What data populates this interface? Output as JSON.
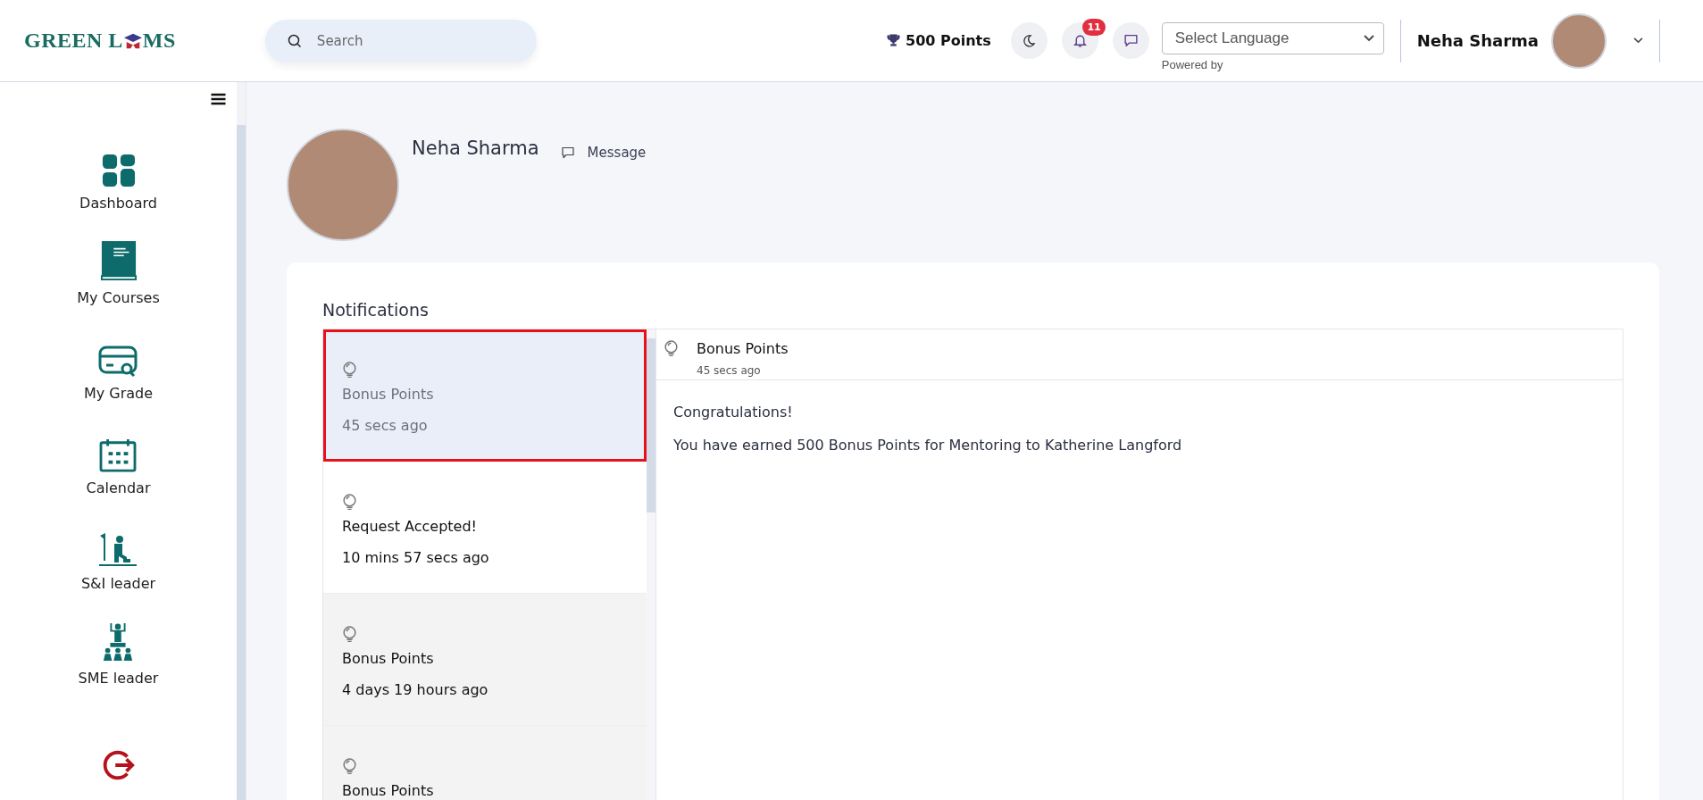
{
  "header": {
    "logo": {
      "part1": "GREEN L",
      "part2": "MS"
    },
    "search": {
      "placeholder": "Search"
    },
    "points": "500 Points",
    "notification_count": "11",
    "language_select": {
      "value": "Select Language",
      "caption": "Powered by"
    },
    "user_name": "Neha Sharma"
  },
  "sidebar": {
    "items": [
      {
        "kind": "dashboard",
        "label": "Dashboard"
      },
      {
        "kind": "courses",
        "label": "My Courses"
      },
      {
        "kind": "grade",
        "label": "My Grade"
      },
      {
        "kind": "calendar",
        "label": "Calendar"
      },
      {
        "kind": "si_leader",
        "label": "S&I leader"
      },
      {
        "kind": "sme_leader",
        "label": "SME leader"
      },
      {
        "kind": "logout"
      }
    ]
  },
  "profile": {
    "name": "Neha Sharma",
    "message_link": "Message"
  },
  "notifications": {
    "title": "Notifications",
    "items": [
      {
        "title": "Bonus Points",
        "time": "45 secs ago",
        "selected": true,
        "read": false
      },
      {
        "title": "Request Accepted!",
        "time": "10 mins 57 secs ago",
        "selected": false,
        "read": false
      },
      {
        "title": "Bonus Points",
        "time": "4 days 19 hours ago",
        "selected": false,
        "read": true
      },
      {
        "title": "Bonus Points",
        "selected": false,
        "read": true
      }
    ],
    "detail": {
      "title": "Bonus Points",
      "time": "45 secs ago",
      "greeting": "Congratulations!",
      "body": "You have earned 500 Bonus Points for Mentoring to Katherine Langford"
    }
  }
}
